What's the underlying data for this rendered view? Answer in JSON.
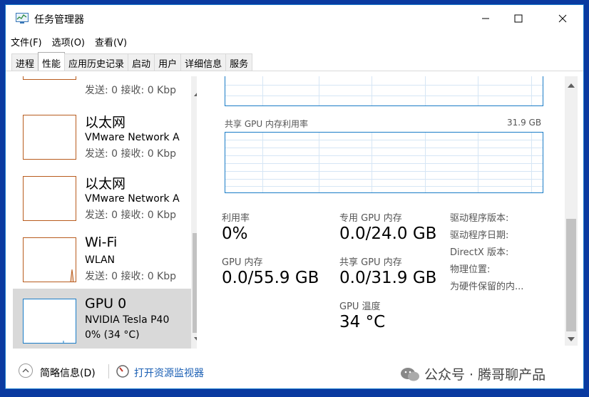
{
  "window": {
    "title": "任务管理器"
  },
  "menu": [
    "文件(F)",
    "选项(O)",
    "查看(V)"
  ],
  "tabs": [
    "进程",
    "性能",
    "应用历史记录",
    "启动",
    "用户",
    "详细信息",
    "服务"
  ],
  "active_tab": "性能",
  "devices": [
    {
      "name": "",
      "sub": "",
      "stat": "发送: 0 接收: 0 Kbp"
    },
    {
      "name": "以太网",
      "sub": "VMware Network A",
      "stat": "发送: 0 接收: 0 Kbp"
    },
    {
      "name": "以太网",
      "sub": "VMware Network A",
      "stat": "发送: 0 接收: 0 Kbp"
    },
    {
      "name": "Wi-Fi",
      "sub": "WLAN",
      "stat": "发送: 0 接收: 0 Kbp"
    },
    {
      "name": "GPU 0",
      "sub": "NVIDIA Tesla P40",
      "stat": "0% (34 °C)"
    }
  ],
  "selected_device": "GPU 0",
  "shared_graph": {
    "label": "共享 GPU 内存利用率",
    "max": "31.9 GB"
  },
  "stats": {
    "utilization": {
      "label": "利用率",
      "value": "0%"
    },
    "dedicated_mem": {
      "label": "专用 GPU 内存",
      "value": "0.0/24.0 GB"
    },
    "gpu_mem": {
      "label": "GPU 内存",
      "value": "0.0/55.9 GB"
    },
    "shared_mem": {
      "label": "共享 GPU 内存",
      "value": "0.0/31.9 GB"
    },
    "gpu_temp": {
      "label": "GPU 温度",
      "value": "34 °C"
    }
  },
  "info_labels": [
    "驱动程序版本:",
    "驱动程序日期:",
    "DirectX 版本:",
    "物理位置:",
    "为硬件保留的内..."
  ],
  "footer": {
    "summary": "简略信息(D)",
    "resource_monitor": "打开资源监视器"
  },
  "watermark": "公众号 · 腾哥聊产品",
  "colors": {
    "graph_border": "#1a7cc7",
    "thumb_border": "#b85c1e",
    "gpu_thumb_border": "#1a7cc7",
    "link": "#1a5fb4"
  }
}
